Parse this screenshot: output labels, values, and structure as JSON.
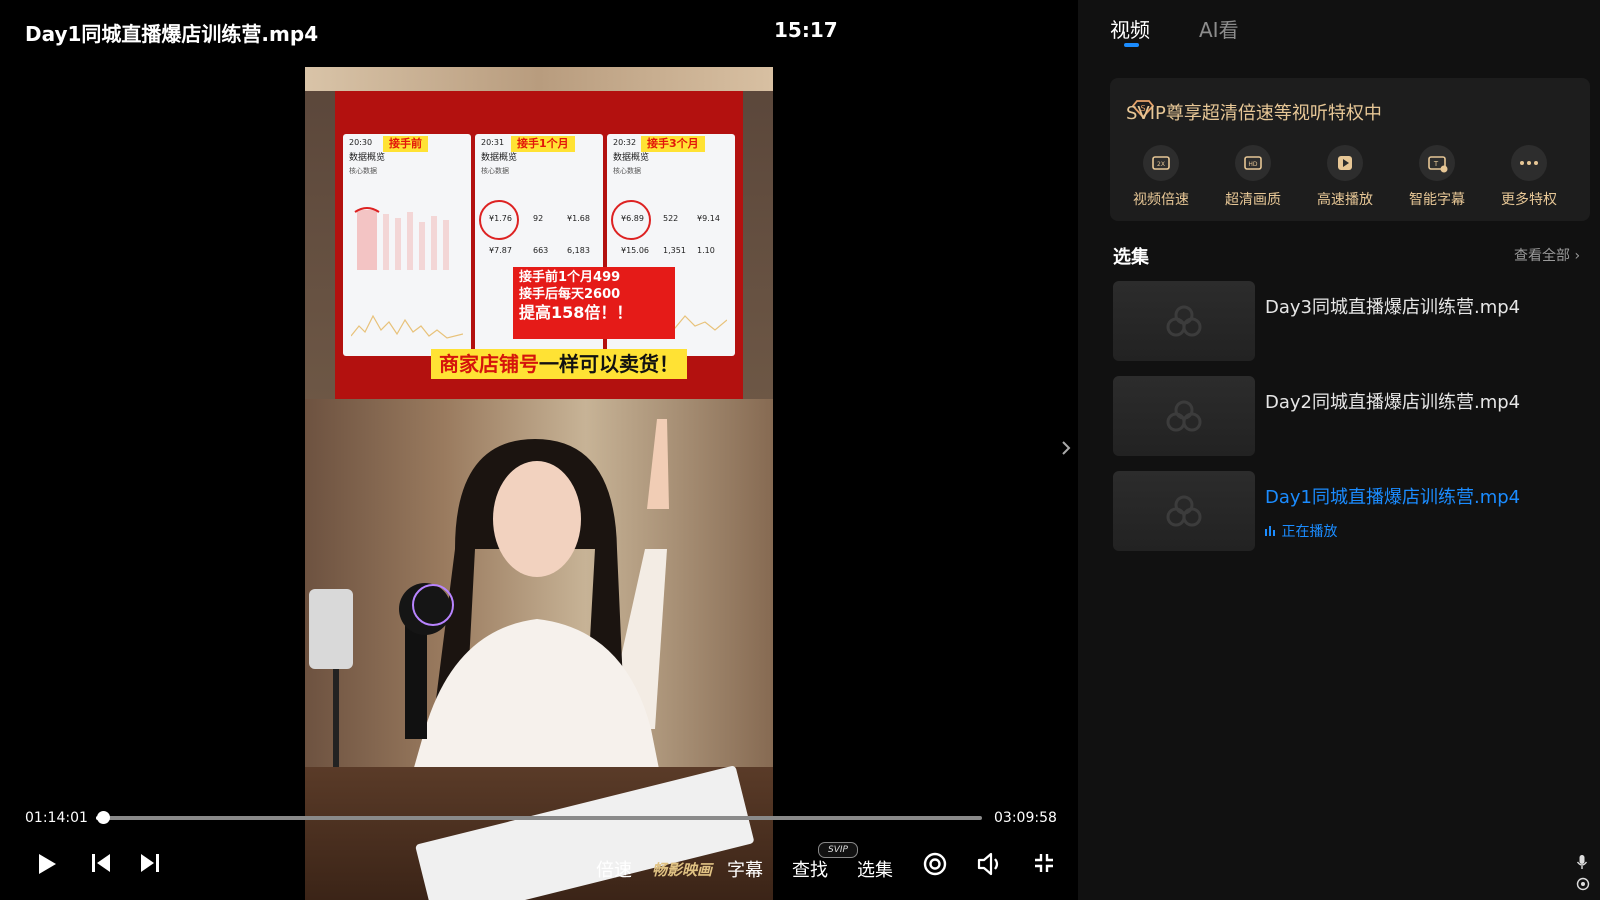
{
  "player": {
    "title": "Day1同城直播爆店训练营.mp4",
    "clock": "15:17",
    "time_current": "01:14:01",
    "time_total": "03:09:58",
    "progress_fraction": 0.0075,
    "video_frame": {
      "tag_1": "接手前",
      "tag_2": "接手1个月",
      "tag_3": "接手3个月",
      "phone_header": "数据概览",
      "phone_section": "核心数据",
      "callout_1": "接手前1个月499",
      "callout_2": "接手后每天2600",
      "callout_3": "提高158倍！！",
      "banner_red": "商家店铺号",
      "banner_black": "一样可以卖货！"
    },
    "controls": {
      "speed": "倍速",
      "effect": "畅影映画",
      "subtitle": "字幕",
      "find": "查找",
      "find_badge": "SVIP",
      "episodes": "选集"
    }
  },
  "sidebar": {
    "tabs": [
      "视频",
      "AI看"
    ],
    "svip_title": "SVIP尊享超清倍速等视听特权中",
    "perks": [
      "视频倍速",
      "超清画质",
      "高速播放",
      "智能字幕",
      "更多特权"
    ],
    "episodes_heading": "选集",
    "view_all": "查看全部",
    "episodes": [
      {
        "title": "Day3同城直播爆店训练营.mp4"
      },
      {
        "title": "Day2同城直播爆店训练营.mp4"
      },
      {
        "title": "Day1同城直播爆店训练营.mp4"
      }
    ],
    "now_playing": "正在播放"
  },
  "colors": {
    "accent_blue": "#1b8cff",
    "svip_gold": "#e7c796",
    "sidebar_bg": "#111111",
    "card_bg": "#1d1d1d"
  },
  "icons": {
    "play": "play-icon",
    "prev": "skip-previous-icon",
    "next": "skip-next-icon",
    "danmaku": "target-icon",
    "volume": "volume-icon",
    "fullscreen_exit": "compress-icon"
  }
}
